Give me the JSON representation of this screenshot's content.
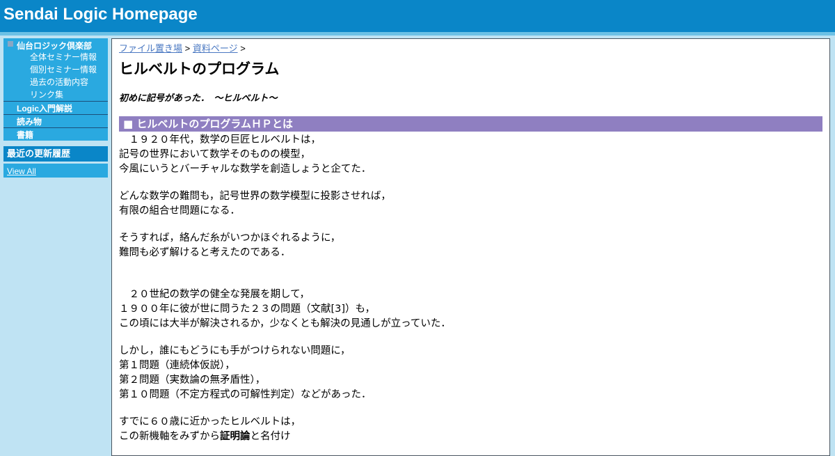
{
  "header": {
    "title": "Sendai Logic Homepage"
  },
  "sidebar": {
    "club": {
      "label": "仙台ロジック倶楽部",
      "sub_items": [
        "全体セミナー情報",
        "個別セミナー情報",
        "過去の活動内容",
        "リンク集"
      ]
    },
    "items": [
      "Logic入門解説",
      "読み物",
      "書籍"
    ],
    "recent_title": "最近の更新履歴",
    "view_all": "View All"
  },
  "breadcrumb": {
    "items": [
      "ファイル置き場",
      "資料ページ"
    ],
    "separator": ">"
  },
  "page": {
    "title": "ヒルベルトのプログラム",
    "lead": "初めに記号があった．　～ヒルベルト～",
    "section_heading": "ヒルベルトのプログラムＨＰとは",
    "paragraphs": [
      [
        "　１９２０年代，数学の巨匠ヒルベルトは，",
        "記号の世界において数学そのものの模型，",
        "今風にいうとバーチャルな数学を創造しょうと企てた．"
      ],
      [
        "どんな数学の難問も，記号世界の数学模型に投影させれば，",
        "有限の組合せ問題になる．"
      ],
      [
        "そうすれば，絡んだ糸がいつかほぐれるように，",
        "難問も必ず解けると考えたのである．"
      ],
      [
        "　２０世紀の数学の健全な発展を期して，",
        "１９００年に彼が世に問うた２３の問題（文献[3]）も，",
        "この頃には大半が解決されるか，少なくとも解決の見通しが立っていた．"
      ],
      [
        "しかし，誰にもどうにも手がつけられない問題に，",
        "第１問題（連続体仮説），",
        "第２問題（実数論の無矛盾性），",
        "第１０問題（不定方程式の可解性判定）などがあった．"
      ],
      [
        "すでに６０歳に近かったヒルベルトは，"
      ]
    ],
    "last_line": {
      "before": "この新機軸をみずから",
      "bold": "証明論",
      "after": "と名付け"
    }
  },
  "colors": {
    "header": "#0a86c8",
    "sidebar": "#2aa9e0",
    "section_bar": "#8f7fc1",
    "page_bg": "#bfe3f3",
    "link": "#4a78c2"
  }
}
